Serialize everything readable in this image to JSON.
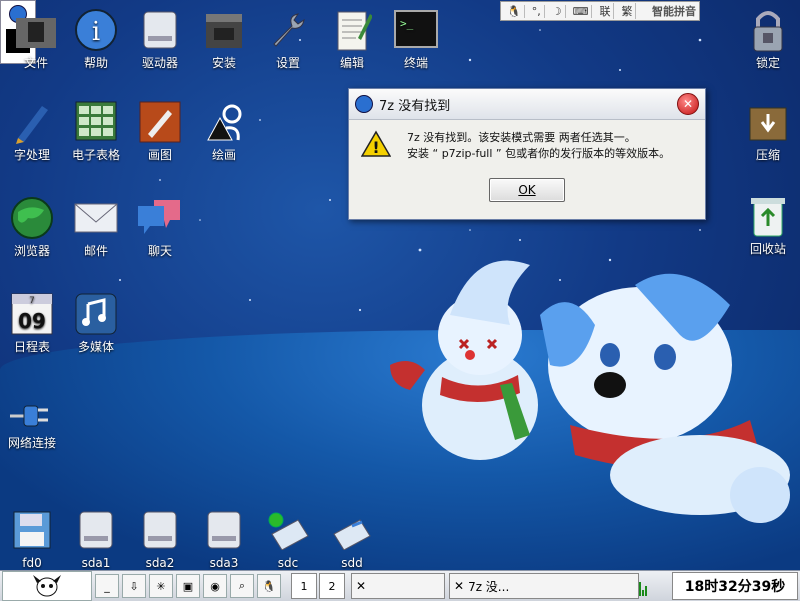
{
  "desktop": {
    "icons_left": [
      {
        "name": "file-manager",
        "label": "文件",
        "icon": "folder-icon"
      },
      {
        "name": "help",
        "label": "帮助",
        "icon": "info-icon"
      },
      {
        "name": "drives",
        "label": "驱动器",
        "icon": "harddisk-icon"
      },
      {
        "name": "install",
        "label": "安装",
        "icon": "box-icon"
      },
      {
        "name": "settings",
        "label": "设置",
        "icon": "wrench-icon"
      },
      {
        "name": "editor",
        "label": "编辑",
        "icon": "notepad-icon"
      },
      {
        "name": "terminal",
        "label": "终端",
        "icon": "terminal-icon"
      },
      {
        "name": "wordproc",
        "label": "字处理",
        "icon": "pen-icon"
      },
      {
        "name": "spreadsheet",
        "label": "电子表格",
        "icon": "grid-icon"
      },
      {
        "name": "paint",
        "label": "画图",
        "icon": "brush-icon"
      },
      {
        "name": "draw",
        "label": "绘画",
        "icon": "shapes-icon"
      },
      {
        "name": "browser",
        "label": "浏览器",
        "icon": "globe-icon"
      },
      {
        "name": "mail",
        "label": "邮件",
        "icon": "envelope-icon"
      },
      {
        "name": "chat",
        "label": "聊天",
        "icon": "speech-icon"
      },
      {
        "name": "calendar",
        "label": "日程表",
        "icon": "calendar-icon"
      },
      {
        "name": "multimedia",
        "label": "多媒体",
        "icon": "media-icon"
      },
      {
        "name": "network",
        "label": "网络连接",
        "icon": "plug-icon"
      }
    ],
    "calendar_day": "09",
    "calendar_month": "7",
    "icons_right": [
      {
        "name": "lock",
        "label": "锁定",
        "icon": "padlock-icon"
      },
      {
        "name": "compress",
        "label": "压缩",
        "icon": "archive-icon"
      },
      {
        "name": "trash",
        "label": "回收站",
        "icon": "trash-icon"
      }
    ],
    "drives": [
      "fd0",
      "sda1",
      "sda2",
      "sda3",
      "sdc",
      "sdd"
    ]
  },
  "ime": {
    "segments": [
      "联",
      "繁"
    ],
    "brand": "智能拼音"
  },
  "dialog": {
    "title": "7z 没有找到",
    "line1": "7z 没有找到。该安装模式需要 两者任选其一。",
    "line2": "安装 “ p7zip-full ” 包或者你的发行版本的等效版本。",
    "ok": "OK"
  },
  "taskbar": {
    "pages": [
      "1",
      "2"
    ],
    "task_label": "7z 没...",
    "clock": "18时32分39秒"
  }
}
